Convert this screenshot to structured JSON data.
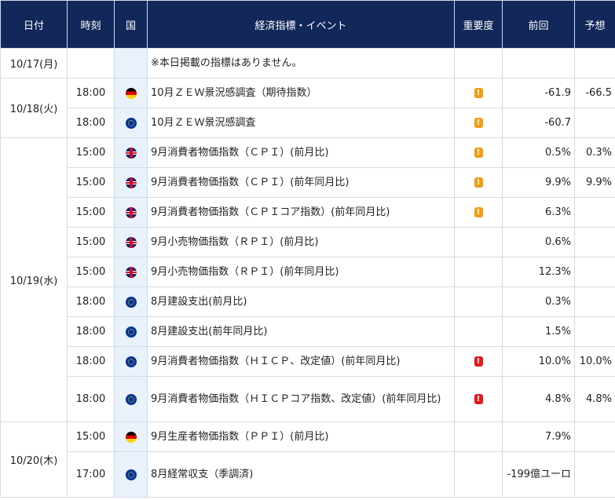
{
  "header": {
    "date": "日付",
    "time": "時刻",
    "country": "国",
    "event": "経済指標・イベント",
    "importance": "重要度",
    "previous": "前回",
    "forecast": "予想"
  },
  "days": [
    {
      "date": "10/17(月)",
      "rows": [
        {
          "time": "",
          "flag": "",
          "event": "※本日掲載の指標はありません。",
          "importance": "",
          "previous": "",
          "forecast": ""
        }
      ]
    },
    {
      "date": "10/18(火)",
      "rows": [
        {
          "time": "18:00",
          "flag": "de-flag-icon",
          "event": "10月ＺＥＷ景況感調査（期待指数）",
          "importance": "medium",
          "previous": "-61.9",
          "forecast": "-66.5"
        },
        {
          "time": "18:00",
          "flag": "eu-flag-icon",
          "event": "10月ＺＥＷ景況感調査",
          "importance": "medium",
          "previous": "-60.7",
          "forecast": ""
        }
      ]
    },
    {
      "date": "10/19(水)",
      "rows": [
        {
          "time": "15:00",
          "flag": "gb-flag-icon",
          "event": "9月消費者物価指数（ＣＰＩ）(前月比)",
          "importance": "medium",
          "previous": "0.5%",
          "forecast": "0.3%"
        },
        {
          "time": "15:00",
          "flag": "gb-flag-icon",
          "event": "9月消費者物価指数（ＣＰＩ）(前年同月比)",
          "importance": "medium",
          "previous": "9.9%",
          "forecast": "9.9%"
        },
        {
          "time": "15:00",
          "flag": "gb-flag-icon",
          "event": "9月消費者物価指数（ＣＰＩコア指数）(前年同月比)",
          "importance": "medium",
          "previous": "6.3%",
          "forecast": ""
        },
        {
          "time": "15:00",
          "flag": "gb-flag-icon",
          "event": "9月小売物価指数（ＲＰＩ）(前月比)",
          "importance": "",
          "previous": "0.6%",
          "forecast": ""
        },
        {
          "time": "15:00",
          "flag": "gb-flag-icon",
          "event": "9月小売物価指数（ＲＰＩ）(前年同月比)",
          "importance": "",
          "previous": "12.3%",
          "forecast": ""
        },
        {
          "time": "18:00",
          "flag": "eu-flag-icon",
          "event": "8月建設支出(前月比)",
          "importance": "",
          "previous": "0.3%",
          "forecast": ""
        },
        {
          "time": "18:00",
          "flag": "eu-flag-icon",
          "event": "8月建設支出(前年同月比)",
          "importance": "",
          "previous": "1.5%",
          "forecast": ""
        },
        {
          "time": "18:00",
          "flag": "eu-flag-icon",
          "event": "9月消費者物価指数（ＨＩＣＰ、改定値）(前年同月比)",
          "importance": "high",
          "previous": "10.0%",
          "forecast": "10.0%"
        },
        {
          "time": "18:00",
          "flag": "eu-flag-icon",
          "event": "9月消費者物価指数（ＨＩＣＰコア指数、改定値）(前年同月比)",
          "importance": "high",
          "previous": "4.8%",
          "forecast": "4.8%"
        }
      ]
    },
    {
      "date": "10/20(木)",
      "rows": [
        {
          "time": "15:00",
          "flag": "de-flag-icon",
          "event": "9月生産者物価指数（ＰＰＩ）(前月比)",
          "importance": "",
          "previous": "7.9%",
          "forecast": ""
        },
        {
          "time": "17:00",
          "flag": "eu-flag-icon",
          "event": "8月経常収支（季調済)",
          "importance": "",
          "previous": "-199億ユーロ",
          "forecast": ""
        }
      ]
    }
  ],
  "importance_marks": {
    "medium": "!",
    "high": "!"
  },
  "colors": {
    "header_bg": "#12275a",
    "flag_col_bg": "#e9f1fb",
    "medium": "#f39c12",
    "high": "#e3191c",
    "border": "#d3dbe6"
  }
}
